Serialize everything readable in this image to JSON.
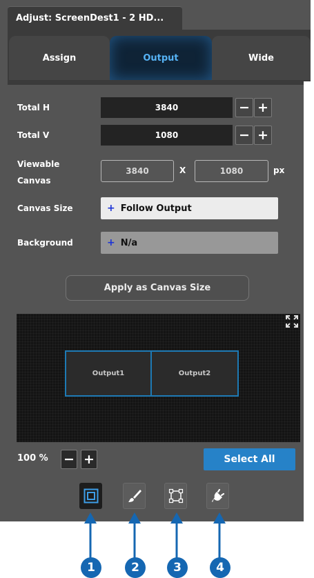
{
  "window": {
    "title": "Adjust: ScreenDest1 - 2 HD..."
  },
  "tabs": [
    {
      "label": "Assign"
    },
    {
      "label": "Output",
      "active": true
    },
    {
      "label": "Wide"
    }
  ],
  "fields": {
    "total_h": {
      "label": "Total H",
      "value": "3840"
    },
    "total_v": {
      "label": "Total V",
      "value": "1080"
    },
    "viewable_canvas": {
      "label_line1": "Viewable",
      "label_line2": "Canvas",
      "width": "3840",
      "separator": "X",
      "height": "1080",
      "unit": "px"
    },
    "canvas_size": {
      "label": "Canvas Size",
      "plus": "+",
      "value": "Follow Output"
    },
    "background": {
      "label": "Background",
      "plus": "+",
      "value": "N/a"
    }
  },
  "steppers": {
    "minus": "−",
    "plus": "+"
  },
  "apply_button": {
    "label": "Apply as Canvas Size"
  },
  "canvas_preview": {
    "outputs": [
      {
        "label": "Output1"
      },
      {
        "label": "Output2"
      }
    ],
    "background_color": "#141414",
    "output_border_color": "#1d7ab5"
  },
  "zoom": {
    "label": "100 %",
    "minus": "−",
    "plus": "+"
  },
  "select_all": {
    "label": "Select All"
  },
  "toolbar": [
    {
      "icon": "layers-icon",
      "active": true
    },
    {
      "icon": "brush-icon"
    },
    {
      "icon": "crop-frame-icon"
    },
    {
      "icon": "plug-icon"
    }
  ],
  "callouts": [
    "1",
    "2",
    "3",
    "4"
  ],
  "colors": {
    "accent": "#2682c8",
    "active_tab_text": "#56b3f5",
    "callout": "#1567b2",
    "panel": "#545454"
  }
}
